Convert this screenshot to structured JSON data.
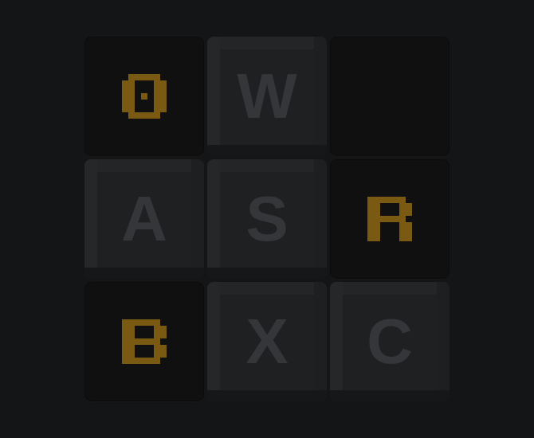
{
  "keypad": {
    "keys": [
      {
        "id": "k1",
        "kind": "glyph",
        "glyph": "pixel-o-icon"
      },
      {
        "id": "k2",
        "kind": "letter",
        "label": "W"
      },
      {
        "id": "k3",
        "kind": "blank"
      },
      {
        "id": "k4",
        "kind": "letter",
        "label": "A"
      },
      {
        "id": "k5",
        "kind": "letter",
        "label": "S"
      },
      {
        "id": "k6",
        "kind": "glyph",
        "glyph": "pixel-r-icon"
      },
      {
        "id": "k7",
        "kind": "glyph",
        "glyph": "pixel-b-icon"
      },
      {
        "id": "k8",
        "kind": "letter",
        "label": "X"
      },
      {
        "id": "k9",
        "kind": "letter",
        "label": "C"
      }
    ]
  },
  "colors": {
    "background": "#141517",
    "glyph": "#7a5a12",
    "letter": "#35363a"
  }
}
